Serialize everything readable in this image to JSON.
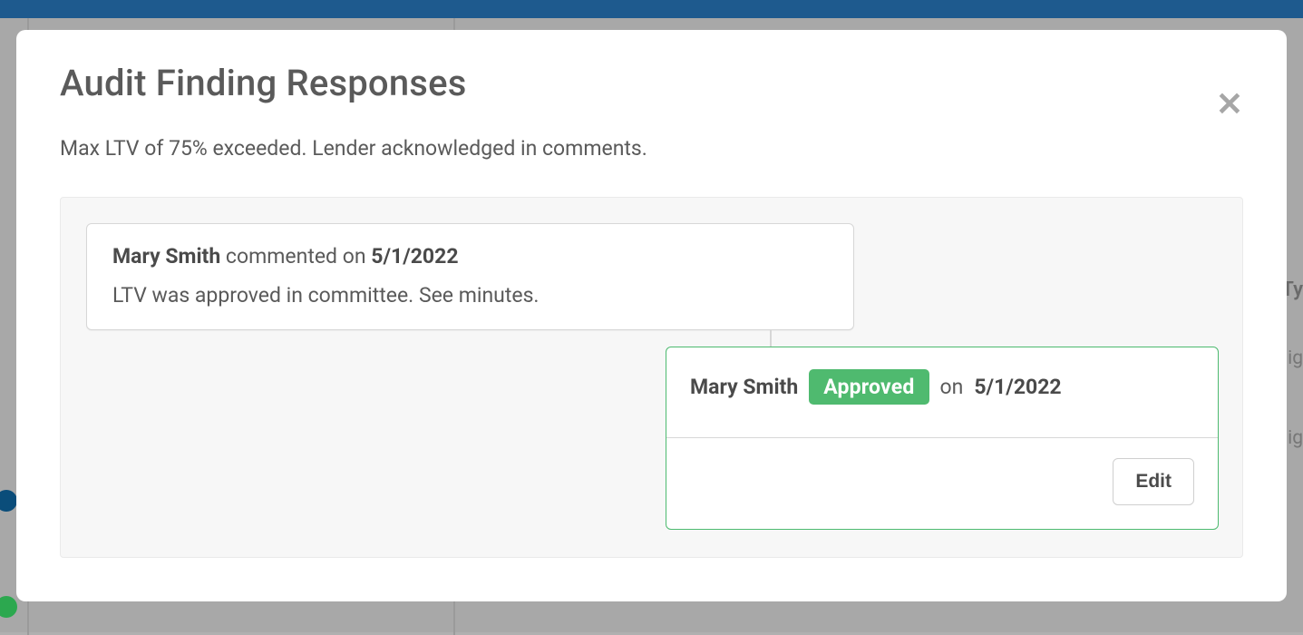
{
  "modal": {
    "title": "Audit Finding Responses",
    "subtitle": "Max LTV of 75% exceeded. Lender acknowledged in comments."
  },
  "comment": {
    "author": "Mary Smith",
    "action_text": "commented on",
    "date": "5/1/2022",
    "body": "LTV was approved in committee. See minutes."
  },
  "approval": {
    "author": "Mary Smith",
    "badge": "Approved",
    "on_text": "on",
    "date": "5/1/2022",
    "edit_label": "Edit"
  },
  "background": {
    "col_header_fragment": "Ty",
    "row1_fragment": "lig",
    "row2_fragment": "lig"
  }
}
